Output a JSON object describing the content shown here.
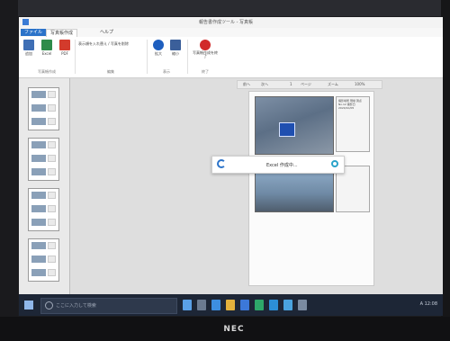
{
  "window": {
    "title": "報告書作成ツール - 写真帳"
  },
  "tabs": [
    "ファイル",
    "写真帳作成",
    "ヘルプ"
  ],
  "ribbon": {
    "buttons": [
      {
        "label": "追加",
        "icon": "add-photo-icon",
        "color": "#3f6fb5"
      },
      {
        "label": "Excel",
        "icon": "excel-icon",
        "color": "#2e8b4a"
      },
      {
        "label": "PDF",
        "icon": "pdf-icon",
        "color": "#d33b2c"
      }
    ],
    "group1_label": "写真帳作成",
    "small_action": "表示順を入れ替え / 写真を削除",
    "group2_label": "編集",
    "zoom_buttons": [
      {
        "label": "拡大",
        "icon": "zoom-icon",
        "color": "#1e5fbf"
      },
      {
        "label": "縮小",
        "icon": "grid-icon",
        "color": "#3b5f9a"
      }
    ],
    "group3_label": "表示",
    "close_button": {
      "label": "写真帳作成を終了",
      "icon": "close-circle-icon",
      "color": "#d12a2a"
    },
    "group4_label": "終了"
  },
  "page_toolbar": [
    "前へ",
    "次へ",
    "1",
    "ページ",
    "ズーム",
    "100%"
  ],
  "note_text": "撮影場所 現場 測点No.12 撮影日 2020/10/05",
  "loading_text": "Excel 作成中...",
  "taskbar": {
    "search_placeholder": "ここに入力して検索",
    "tray": "A 12:08"
  },
  "brand": "NEC"
}
